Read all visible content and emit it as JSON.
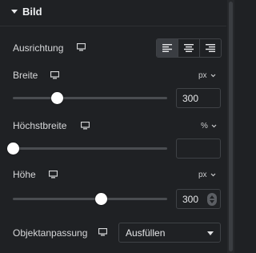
{
  "section": {
    "title": "Bild",
    "caret_icon": "caret-down-icon"
  },
  "alignment": {
    "label": "Ausrichtung",
    "device_icon": "desktop-icon",
    "options": [
      "align-left",
      "align-center",
      "align-right"
    ],
    "selected": "align-left"
  },
  "width": {
    "label": "Breite",
    "device_icon": "desktop-icon",
    "unit": "px",
    "value": "300",
    "slider_fraction": 0.29
  },
  "max_width": {
    "label": "Höchstbreite",
    "device_icon": "desktop-icon",
    "unit": "%",
    "value": "",
    "slider_fraction": 0.0
  },
  "height": {
    "label": "Höhe",
    "device_icon": "desktop-icon",
    "unit": "px",
    "value": "300",
    "slider_fraction": 0.57
  },
  "object_fit": {
    "label": "Objektanpassung",
    "device_icon": "desktop-icon",
    "value": "Ausfüllen"
  },
  "colors": {
    "background": "#1f2124",
    "text": "#d6d7d9",
    "border": "#3f4246",
    "active_button": "#3a3d42",
    "slider_thumb": "#ffffff"
  }
}
